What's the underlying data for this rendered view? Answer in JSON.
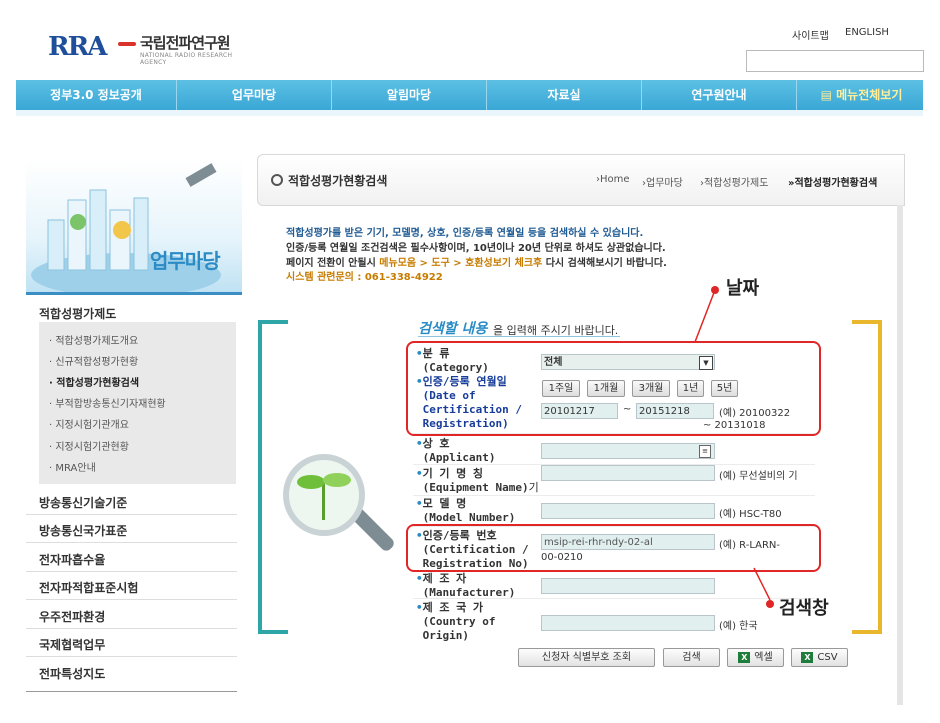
{
  "header": {
    "logo_mark": "RRA",
    "logo_kr": "국립전파연구원",
    "logo_en": "NATIONAL RADIO RESEARCH AGENCY",
    "sitemap": "사이트맵",
    "english": "ENGLISH",
    "search_placeholder": ""
  },
  "nav": {
    "items": [
      "정부3.0 정보공개",
      "업무마당",
      "알림마당",
      "자료실",
      "연구원안내"
    ],
    "all_menu": "메뉴전체보기"
  },
  "sidebar": {
    "banner_title": "업무마당",
    "section": "적합성평가제도",
    "sub_items": [
      "적합성평가제도개요",
      "신규적합성평가현황",
      "적합성평가현황검색",
      "부적합방송통신기자재현황",
      "지정시험기관개요",
      "지정시험기관현황",
      "MRA안내"
    ],
    "active_index": 2,
    "main_items": [
      "방송통신기술기준",
      "방송통신국가표준",
      "전자파흡수율",
      "전자파적합표준시험",
      "우주전파환경",
      "국제협력업무",
      "전파특성지도"
    ]
  },
  "page": {
    "title": "적합성평가현황검색",
    "breadcrumb": [
      "Home",
      "업무마당",
      "적합성평가제도",
      "적합성평가현황검색"
    ]
  },
  "notice": {
    "line1": "적합성평가를 받은 기기, 모델명, 상호, 인증/등록 연월일 등을 검색하실 수 있습니다.",
    "line2": "인증/등록 연월일 조건검색은 필수사항이며, 10년이나 20년 단위로 하셔도 상관없습니다.",
    "line3_a": "페이지 전환이 안될시 ",
    "line3_hl1": "메뉴모음 > 도구 > 호환성보기",
    "line3_b": " ",
    "line3_hl2": "체크후",
    "line3_c": " 다시 검색해보시기 바랍니다.",
    "contact_label": "시스템 관련문의 : ",
    "contact_number": "061-338-4922"
  },
  "form": {
    "title_em": "검색할 내용",
    "title_rest": "을 입력해 주시기 바랍니다.",
    "category": {
      "label": "분     류",
      "label_en": "(Category)",
      "value": "전체"
    },
    "date": {
      "label": "인증/등록 연월일",
      "label_en1": "(Date of",
      "label_en2": "Certification /",
      "label_en3": "Registration)",
      "quick": [
        "1주일",
        "1개월",
        "3개월",
        "1년",
        "5년"
      ],
      "from": "20101217",
      "tilde": "~",
      "to": "20151218",
      "example": "(예) 20100322",
      "example2": "~ 20131018"
    },
    "applicant": {
      "label": "상     호",
      "label_en": "(Applicant)",
      "value": ""
    },
    "equipment": {
      "label": "기 기 명 칭",
      "label_en": "(Equipment Name)",
      "suffix": "기",
      "value": "",
      "example": "(예) 무선설비의 기"
    },
    "model": {
      "label": "모  델  명",
      "label_en": "(Model  Number)",
      "value": "",
      "example": "(예) HSC-T80"
    },
    "certno": {
      "label": "인증/등록 번호",
      "label_en1": "(Certification /",
      "label_en2": "Registration No)",
      "value": "msip-rei-rhr-ndy-02-al",
      "example1": "(예) R-LARN-",
      "example2": "00-0210"
    },
    "manufacturer": {
      "label": "제  조  자",
      "label_en": "(Manufacturer)",
      "value": ""
    },
    "country": {
      "label": "제 조 국 가",
      "label_en1": "(Country of",
      "label_en2": "Origin)",
      "value": "",
      "example": "(예) 한국"
    }
  },
  "actions": {
    "applicant_lookup": "신청자 식별부호 조회",
    "search": "검색",
    "excel": "엑셀",
    "csv": "CSV"
  },
  "annotations": {
    "date": "날짜",
    "searchbox": "검색창"
  },
  "colors": {
    "nav": "#3aa7d6",
    "accent_teal": "#2ea5a7",
    "accent_yellow": "#e8b72b",
    "highlight_red": "#e02626"
  }
}
